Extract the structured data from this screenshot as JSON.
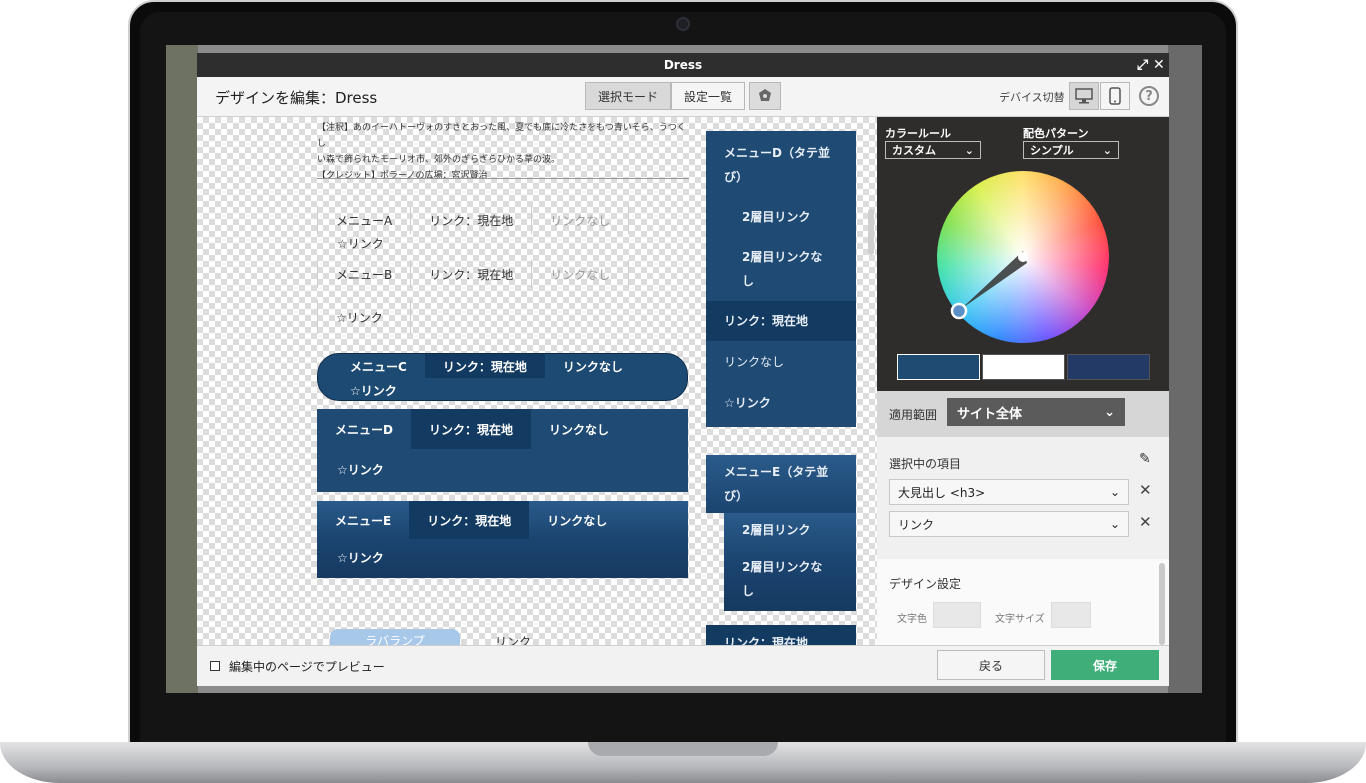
{
  "titlebar": {
    "title": "Dress"
  },
  "toolbar": {
    "title": "デザインを編集：Dress",
    "mode_select": "選択モード",
    "mode_settings": "設定一覧",
    "device_label": "デバイス切替"
  },
  "canvas": {
    "note_line1": "【注釈】あのイーハトーヴォのすきとおった風、夏でも底に冷たさをもつ青いそら、うつくし",
    "note_line2": "い森で飾られたモーリオ市、郊外のぎらぎらひかる草の波。",
    "note_line3": "【クレジット】ポラーノの広場：宮沢賢治",
    "menuA": {
      "label": "メニューA",
      "current": "リンク：現在地",
      "nolink": "リンクなし",
      "star": "☆リンク"
    },
    "menuB": {
      "label": "メニューB",
      "current": "リンク：現在地",
      "nolink": "リンクなし",
      "star": "☆リンク"
    },
    "menuC": {
      "label": "メニューC",
      "current": "リンク：現在地",
      "nolink": "リンクなし",
      "star": "☆リンク"
    },
    "menuD": {
      "label": "メニューD",
      "current": "リンク：現在地",
      "nolink": "リンクなし",
      "star": "☆リンク"
    },
    "menuE": {
      "label": "メニューE",
      "current": "リンク：現在地",
      "nolink": "リンクなし",
      "star": "☆リンク"
    },
    "pill": "ラバランプ",
    "plain_link": "リンク",
    "vD": {
      "title1": "メニューD（タテ並",
      "title2": "び）",
      "sub1": "2層目リンク",
      "sub2a": "2層目リンクな",
      "sub2b": "し",
      "current": "リンク：現在地",
      "nolink": "リンクなし",
      "star": "☆リンク"
    },
    "vE": {
      "title1": "メニューE（タテ並",
      "title2": "び）",
      "sub1": "2層目リンク",
      "sub2a": "2層目リンクな",
      "sub2b": "し",
      "current": "リンク：現在地"
    }
  },
  "panel": {
    "color_rule_label": "カラールール",
    "color_rule_value": "カスタム",
    "pattern_label": "配色パターン",
    "pattern_value": "シンプル",
    "swatch_colors": [
      "#1f4a72",
      "#ffffff",
      "#243a66"
    ],
    "scope_label": "適用範囲",
    "scope_value": "サイト全体",
    "selected_title": "選択中の項目",
    "selected_items": [
      "大見出し <h3>",
      "リンク"
    ],
    "design_title": "デザイン設定",
    "text_color_label": "文字色",
    "text_size_label": "文字サイズ"
  },
  "footer": {
    "preview_label": "編集中のページでプレビュー",
    "back": "戻る",
    "save": "保存"
  },
  "colors": {
    "accent_save": "#3fae78",
    "menu_blue": "#1e4a74"
  }
}
